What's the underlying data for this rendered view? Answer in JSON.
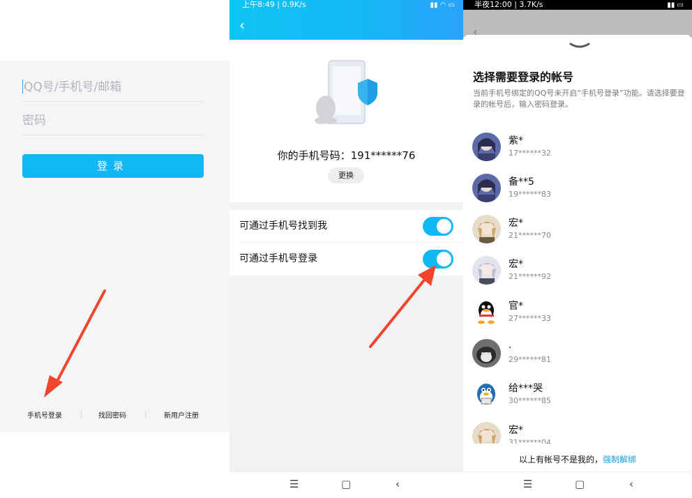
{
  "panel1": {
    "username_placeholder": "QQ号/手机号/邮箱",
    "password_placeholder": "密码",
    "login_label": "登录",
    "links": [
      "手机号登录",
      "找回密码",
      "新用户注册"
    ]
  },
  "panel2": {
    "status_text": "上午8:49 | 0.9K/s",
    "phone_text": "你的手机号码：191******76",
    "change_label": "更换",
    "toggles": [
      {
        "label": "可通过手机号找到我",
        "on": true
      },
      {
        "label": "可通过手机号登录",
        "on": true
      }
    ]
  },
  "panel3": {
    "status_text": "半夜12:00 | 3.7K/s",
    "title": "选择需要登录的帐号",
    "description": "当前手机号绑定的QQ号未开启“手机号登录”功能。请选择要登录的帐号后，输入密码登录。",
    "accounts": [
      {
        "name": "紫*",
        "phone": "17******32",
        "avatar": "anime-girl-blue"
      },
      {
        "name": "备**5",
        "phone": "19******83",
        "avatar": "anime-girl-blue"
      },
      {
        "name": "宏*",
        "phone": "21******70",
        "avatar": "anime-boy-blond"
      },
      {
        "name": "宏*",
        "phone": "21******92",
        "avatar": "anime-boy-silver"
      },
      {
        "name": "官*",
        "phone": "27******33",
        "avatar": "qq-penguin"
      },
      {
        "name": ".",
        "phone": "29******81",
        "avatar": "cat-photo"
      },
      {
        "name": "给***哭",
        "phone": "30******85",
        "avatar": "penguin-cartoon"
      },
      {
        "name": "宏*",
        "phone": "31******04",
        "avatar": "anime-boy-blond"
      }
    ],
    "footer_text": "以上有帐号不是我的，",
    "footer_link": "强制解绑"
  },
  "colors": {
    "accent": "#12b7f5",
    "arrow": "#f0462c",
    "link": "#1a9ee6"
  }
}
